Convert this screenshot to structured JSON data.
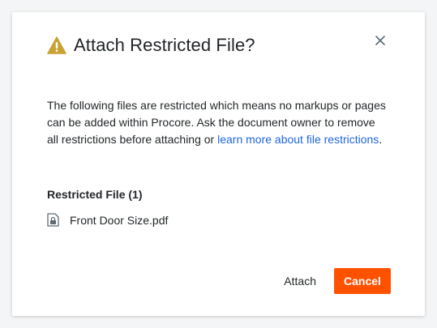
{
  "dialog": {
    "title": "Attach Restricted File?",
    "icons": {
      "warning": "warning-triangle-icon",
      "close": "close-icon",
      "file": "locked-file-icon"
    },
    "body": {
      "text_before_link": "The following files are restricted which means no markups or pages can be added within Procore. Ask the document owner to remove all restrictions before attaching or ",
      "link_text": "learn more about file restrictions",
      "text_after_link": "."
    },
    "restricted_section_title": "Restricted File (1)",
    "files": [
      {
        "name": "Front Door Size.pdf"
      }
    ],
    "buttons": {
      "attach_label": "Attach",
      "cancel_label": "Cancel"
    }
  },
  "colors": {
    "accent": "#ff5200",
    "link": "#2066df",
    "warning": "#c9a233"
  }
}
